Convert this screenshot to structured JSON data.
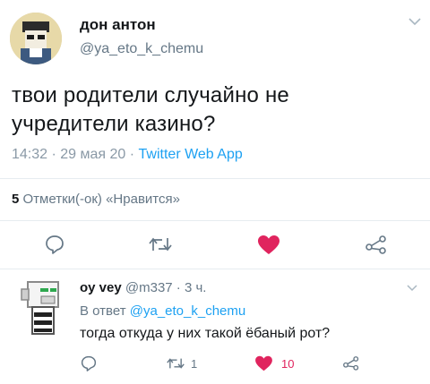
{
  "tweet": {
    "author_name": "дон антон",
    "author_handle": "@ya_eto_k_chemu",
    "text": "твои родители случайно не учредители казино?",
    "time": "14:32 · 29 мая 20 · ",
    "source": "Twitter Web App",
    "likes_count": "5",
    "likes_label": "Отметки(-ок) «Нравится»",
    "actions": {
      "reply_icon": "reply-icon",
      "retweet_icon": "retweet-icon",
      "like_icon": "heart-icon",
      "like_color": "#e0245e",
      "share_icon": "share-icon"
    }
  },
  "reply": {
    "author_name": "oy vey",
    "author_handle": "@m337",
    "time": "· 3 ч.",
    "reply_to_prefix": "В ответ ",
    "reply_to_handle": "@ya_eto_k_chemu",
    "text": "тогда откуда у них такой ёбаный рот?",
    "retweet_count": "1",
    "like_count": "10"
  },
  "colors": {
    "link": "#1da1f2",
    "muted": "#657786",
    "like": "#e0245e"
  }
}
